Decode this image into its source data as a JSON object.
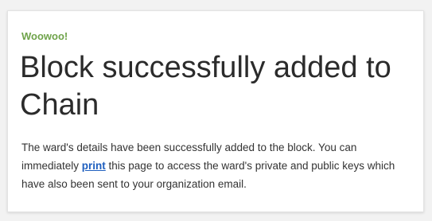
{
  "notice": {
    "eyebrow": "Woowoo!",
    "title": "Block successfully added to Chain",
    "message_before_link": "The ward's details have been successfully added to the block. You can immediately ",
    "link_text": "print",
    "message_after_link": " this page to access the ward's private and public keys which have also been sent to your organization email.",
    "colors": {
      "eyebrow": "#6fa34a",
      "link": "#1f5fbf",
      "title": "#2b2b2b"
    }
  }
}
